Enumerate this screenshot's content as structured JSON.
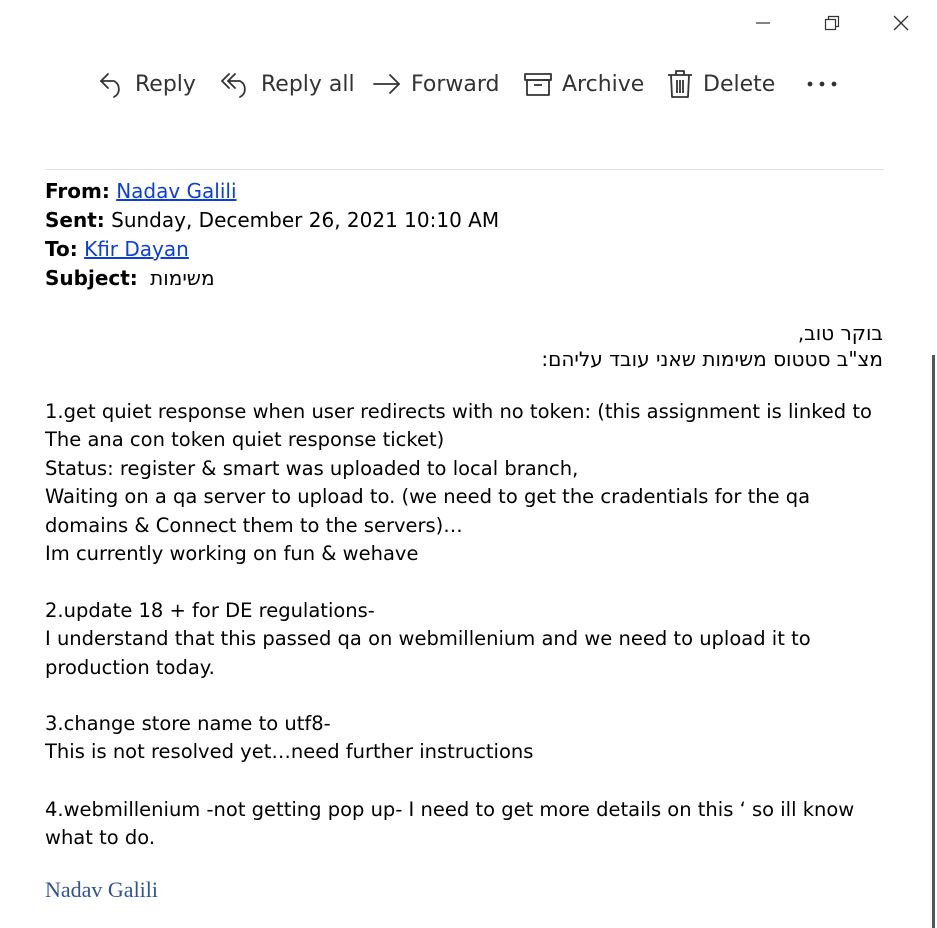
{
  "window_controls": {
    "minimize": "minimize",
    "restore": "restore",
    "close": "close"
  },
  "toolbar": {
    "reply": "Reply",
    "reply_all": "Reply all",
    "forward": "Forward",
    "archive": "Archive",
    "delete": "Delete"
  },
  "header": {
    "from_label": "From:",
    "from_name": "Nadav Galili",
    "sent_label": "Sent:",
    "sent_value": "Sunday, December 26, 2021 10:10 AM",
    "to_label": "To:",
    "to_name": "Kfir Dayan",
    "subject_label": "Subject:",
    "subject_value": "משימות"
  },
  "greeting": {
    "line1": "בוקר טוב,",
    "line2": "מצ\"ב סטטוס משימות שאני עובד עליהם:"
  },
  "items": [
    {
      "lines": [
        "1.get quiet response when user redirects with no token: (this assignment is linked to",
        "The ana con token quiet response ticket)",
        "Status: register & smart was uploaded to local branch,",
        "Waiting on a qa server to upload to. (we need to get the cradentials for the qa domains & Connect them to the servers)…",
        "Im currently working on fun & wehave"
      ]
    },
    {
      "lines": [
        "2.update 18 + for DE regulations-",
        "I understand that this passed qa on webmillenium and we need to upload it to production today."
      ]
    },
    {
      "lines": [
        "3.change store name to utf8-",
        "This is not resolved yet…need further instructions"
      ]
    },
    {
      "lines": [
        "4.webmillenium -not getting pop up- I need to get more details on this ‘ so ill know what to do."
      ]
    }
  ],
  "signature": "Nadav Galili",
  "icons": [
    "minimize-icon",
    "restore-icon",
    "close-icon",
    "reply-icon",
    "reply-all-icon",
    "forward-icon",
    "archive-icon",
    "delete-icon",
    "more-icon"
  ],
  "colors": {
    "link": "#0b3fd9",
    "signature": "#2f5597",
    "toolbar_text": "#333333"
  }
}
